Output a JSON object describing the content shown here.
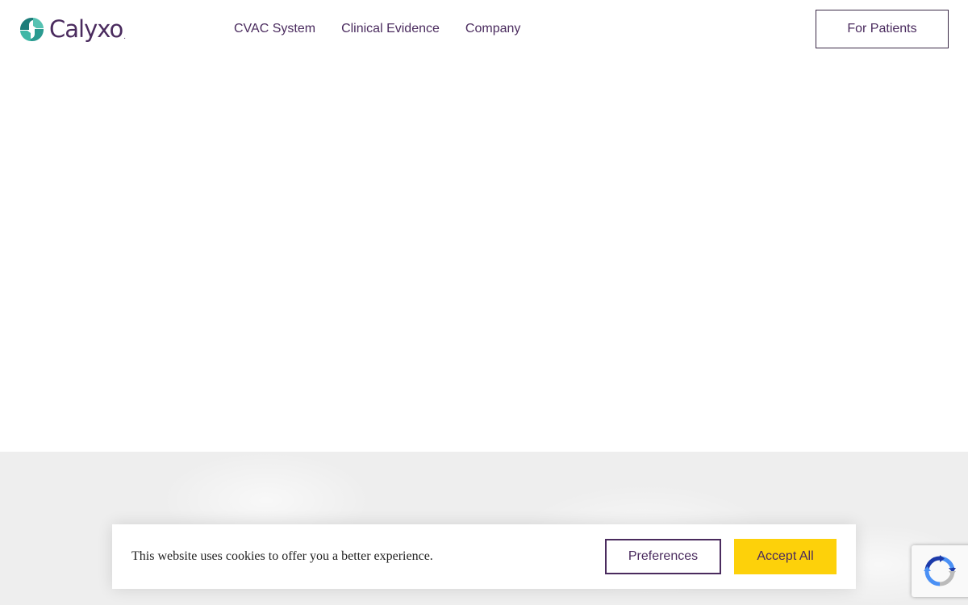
{
  "brand": {
    "name": "Calyxo",
    "registered_mark": "."
  },
  "nav": {
    "items": [
      {
        "label": "CVAC System"
      },
      {
        "label": "Clinical Evidence"
      },
      {
        "label": "Company"
      }
    ],
    "cta_label": "For Patients"
  },
  "cookie_banner": {
    "message": "This website uses cookies to offer you a better experience.",
    "preferences_label": "Preferences",
    "accept_label": "Accept All"
  },
  "colors": {
    "brand_purple": "#4a2b5e",
    "brand_teal": "#2fa89a",
    "accept_yellow": "#fdd10a",
    "section_grey": "#eeeeee"
  },
  "icons": {
    "logo": "calyxo-logo-mark-icon",
    "recaptcha": "recaptcha-icon"
  }
}
